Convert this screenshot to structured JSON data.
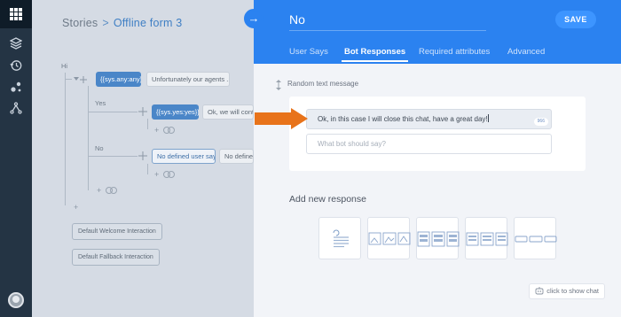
{
  "sidebar": {
    "icons": [
      "grid-icon",
      "layers-icon",
      "history-icon",
      "nodes-icon",
      "fork-icon"
    ],
    "active_index": 0
  },
  "canvas": {
    "breadcrumb": {
      "root": "Stories",
      "separator": ">",
      "current": "Offline form 3"
    },
    "intent_label": "Hi",
    "root_intent": "{{sys.any:any}}",
    "root_response": "Unfortunately our agents ...",
    "branch_yes_label": "Yes",
    "branch_yes_intent": "{{sys.yes:yes}}",
    "branch_yes_response": "Ok, we will conta",
    "branch_no_label": "No",
    "branch_no_intent": "No defined user says",
    "branch_no_response": "No defined",
    "default_welcome": "Default Welcome Interaction",
    "default_fallback": "Default Fallback Interaction"
  },
  "panel": {
    "title": "No",
    "save_label": "SAVE",
    "tabs": [
      "User Says",
      "Bot Responses",
      "Required attributes",
      "Advanced"
    ],
    "active_tab": "Bot Responses",
    "section_label": "Random text message",
    "message_value": "Ok, in this case I will close this chat, have a great day!",
    "message_counter": "966",
    "message_placeholder": "What bot should say?",
    "add_response_label": "Add new response",
    "response_types": [
      "text-response-icon",
      "image-gallery-icon",
      "card-list-icon",
      "button-list-icon",
      "quick-reply-icon"
    ],
    "chat_button": "click to show chat"
  },
  "colors": {
    "accent": "#2b82f0",
    "rail": "#243444",
    "arrow": "#e8731a"
  }
}
